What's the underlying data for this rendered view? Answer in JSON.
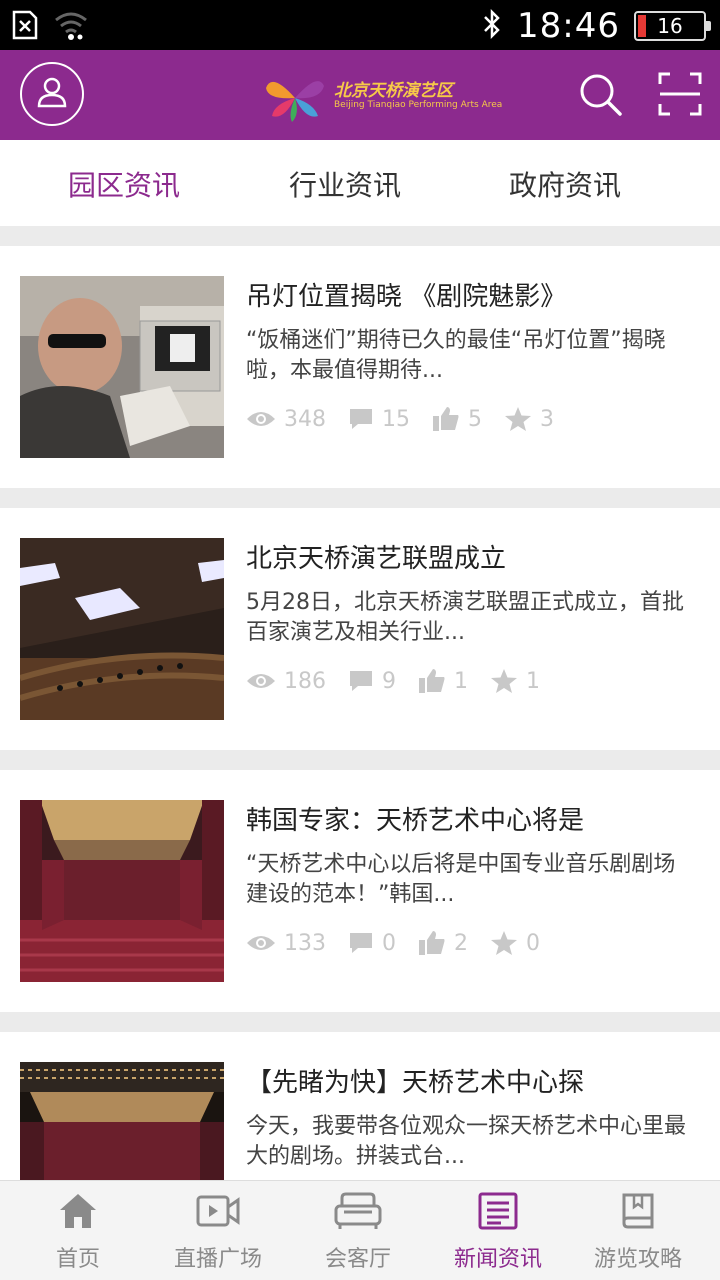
{
  "status_bar": {
    "time": "18:46",
    "battery": "16",
    "icons": [
      "sim-error-icon",
      "wifi-icon",
      "bluetooth-icon",
      "battery-icon"
    ]
  },
  "header": {
    "logo_title": "北京天桥演艺区",
    "logo_subtitle": "Beijing Tianqiao Performing Arts Area",
    "icons": [
      "user-icon",
      "search-icon",
      "scan-icon"
    ]
  },
  "tabs": [
    {
      "label": "园区资讯",
      "active": true
    },
    {
      "label": "行业资讯",
      "active": false
    },
    {
      "label": "政府资讯",
      "active": false
    }
  ],
  "articles": [
    {
      "title": "吊灯位置揭晓 《剧院魅影》",
      "desc": "“饭桶迷们”期待已久的最佳“吊灯位置”揭晓啦，本最值得期待...",
      "views": "348",
      "comments": "15",
      "likes": "5",
      "favorites": "3"
    },
    {
      "title": "北京天桥演艺联盟成立",
      "desc": "5月28日，北京天桥演艺联盟正式成立，首批百家演艺及相关行业...",
      "views": "186",
      "comments": "9",
      "likes": "1",
      "favorites": "1"
    },
    {
      "title": "韩国专家：天桥艺术中心将是",
      "desc": "“天桥艺术中心以后将是中国专业音乐剧剧场建设的范本！”韩国...",
      "views": "133",
      "comments": "0",
      "likes": "2",
      "favorites": "0"
    },
    {
      "title": "【先睹为快】天桥艺术中心探",
      "desc": "今天，我要带各位观众一探天桥艺术中心里最大的剧场。拼装式台...",
      "views": "",
      "comments": "",
      "likes": "",
      "favorites": ""
    }
  ],
  "bottom_nav": [
    {
      "label": "首页",
      "icon": "home-icon",
      "active": false
    },
    {
      "label": "直播广场",
      "icon": "video-icon",
      "active": false
    },
    {
      "label": "会客厅",
      "icon": "sofa-icon",
      "active": false
    },
    {
      "label": "新闻资讯",
      "icon": "news-icon",
      "active": true
    },
    {
      "label": "游览攻略",
      "icon": "book-icon",
      "active": false
    }
  ],
  "colors": {
    "brand": "#8c2a8e",
    "muted": "#c8c8c8",
    "nav_inactive": "#8a8a8a"
  }
}
